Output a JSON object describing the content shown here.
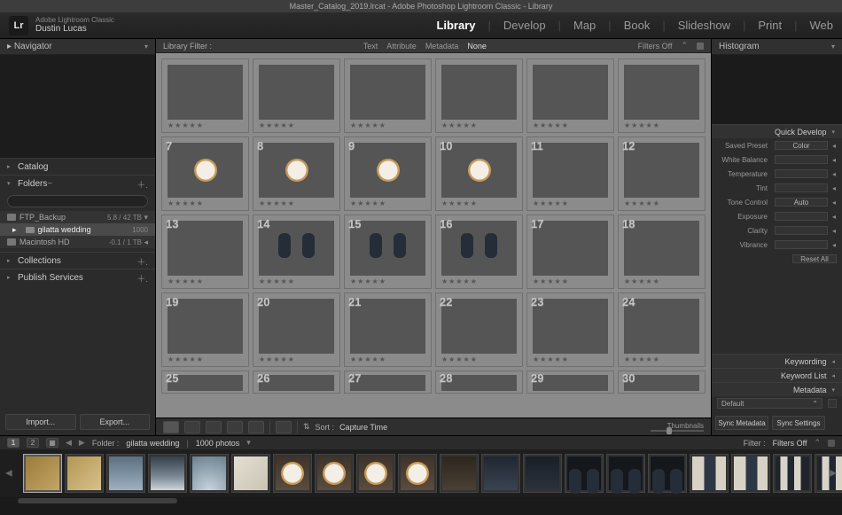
{
  "macbar": {
    "title": "Master_Catalog_2019.lrcat - Adobe Photoshop Lightroom Classic - Library"
  },
  "header": {
    "brand_line1": "Adobe Lightroom Classic",
    "brand_line2": "Dustin Lucas",
    "logo_text": "Lr",
    "modules": [
      "Library",
      "Develop",
      "Map",
      "Book",
      "Slideshow",
      "Print",
      "Web"
    ],
    "active_module": "Library"
  },
  "left": {
    "navigator": "Navigator",
    "catalog": "Catalog",
    "folders": "Folders",
    "collections": "Collections",
    "publish": "Publish Services",
    "volumes": [
      {
        "name": "FTP_Backup",
        "meta": "5.8 / 42 TB"
      },
      {
        "name": "Macintosh HD",
        "meta": "-0.1 / 1 TB"
      }
    ],
    "folder_items": [
      {
        "name": "gilatta wedding",
        "count": "1000"
      }
    ],
    "import_btn": "Import...",
    "export_btn": "Export..."
  },
  "filterbar": {
    "label": "Library Filter :",
    "tabs": [
      "Text",
      "Attribute",
      "Metadata",
      "None"
    ],
    "filters_off": "Filters Off"
  },
  "grid": {
    "rating": "★★★★★",
    "rows": [
      [
        {
          "n": "",
          "t": "t-hotel"
        },
        {
          "n": "",
          "t": "t-hotel2"
        },
        {
          "n": "",
          "t": "t-arch"
        },
        {
          "n": "",
          "t": "t-arch2"
        },
        {
          "n": "",
          "t": "t-sky"
        },
        {
          "n": "",
          "t": "t-paper"
        }
      ],
      [
        {
          "n": "7",
          "t": "t-watch"
        },
        {
          "n": "8",
          "t": "t-watch"
        },
        {
          "n": "9",
          "t": "t-watch"
        },
        {
          "n": "10",
          "t": "t-watch"
        },
        {
          "n": "11",
          "t": "t-cuff"
        },
        {
          "n": "12",
          "t": "t-shoebox"
        }
      ],
      [
        {
          "n": "13",
          "t": "t-bow"
        },
        {
          "n": "14",
          "t": "t-shoes"
        },
        {
          "n": "15",
          "t": "t-shoes"
        },
        {
          "n": "16",
          "t": "t-shoes"
        },
        {
          "n": "17",
          "t": "t-groom"
        },
        {
          "n": "18",
          "t": "t-groom"
        }
      ],
      [
        {
          "n": "19",
          "t": "t-group"
        },
        {
          "n": "20",
          "t": "t-group"
        },
        {
          "n": "21",
          "t": "t-group"
        },
        {
          "n": "22",
          "t": "t-group"
        },
        {
          "n": "23",
          "t": "t-group"
        },
        {
          "n": "24",
          "t": "t-hall"
        }
      ],
      [
        {
          "n": "25",
          "t": "t-group"
        },
        {
          "n": "26",
          "t": "t-group"
        },
        {
          "n": "27",
          "t": "t-group"
        },
        {
          "n": "28",
          "t": "t-group"
        },
        {
          "n": "29",
          "t": "t-group"
        },
        {
          "n": "30",
          "t": "t-group"
        }
      ]
    ]
  },
  "center_toolbar": {
    "sort_label": "Sort :",
    "sort_value": "Capture Time",
    "thumbnails": "Thumbnails"
  },
  "right": {
    "histogram": "Histogram",
    "quick_develop": "Quick Develop",
    "rows": [
      {
        "label": "Saved Preset",
        "value": "Color"
      },
      {
        "label": "White Balance",
        "value": ""
      },
      {
        "label": "Temperature",
        "value": ""
      },
      {
        "label": "Tint",
        "value": ""
      },
      {
        "label": "Tone Control",
        "value": "Auto"
      },
      {
        "label": "Exposure",
        "value": ""
      },
      {
        "label": "Clarity",
        "value": ""
      },
      {
        "label": "Vibrance",
        "value": ""
      }
    ],
    "reset_all": "Reset All",
    "keywording": "Keywording",
    "keyword_list": "Keyword List",
    "metadata": "Metadata",
    "metadata_preset": "Default",
    "sync_metadata": "Sync Metadata",
    "sync_settings": "Sync Settings"
  },
  "secondary": {
    "pages": [
      "1",
      "2"
    ],
    "folder_label": "Folder :",
    "folder_value": "gilatta wedding",
    "count": "1000 photos",
    "filter_label": "Filter :",
    "filter_value": "Filters Off"
  },
  "filmstrip": {
    "thumbs": [
      "t-hotel",
      "t-hotel2",
      "t-arch",
      "t-arch2",
      "t-sky",
      "t-paper",
      "t-watch",
      "t-watch",
      "t-watch",
      "t-watch",
      "t-cuff",
      "t-shoebox",
      "t-bow",
      "t-shoes",
      "t-shoes",
      "t-shoes",
      "t-groom",
      "t-groom",
      "t-group",
      "t-group"
    ]
  }
}
